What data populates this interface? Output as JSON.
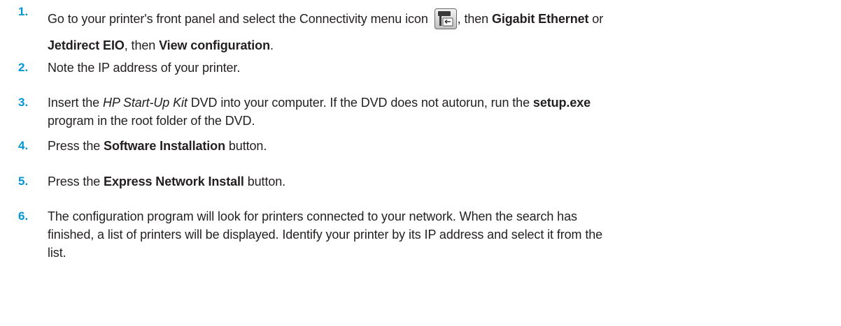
{
  "steps": [
    {
      "number": "1.",
      "parts": {
        "a": "Go to your printer's front panel and select the Connectivity menu icon",
        "b": ", then ",
        "c": "Gigabit Ethernet",
        "d": " or",
        "e": "Jetdirect EIO",
        "f": ", then ",
        "g": "View configuration",
        "h": "."
      },
      "icon": "connectivity-menu-icon"
    },
    {
      "number": "2.",
      "parts": {
        "a": "Note the IP address of your printer."
      }
    },
    {
      "number": "3.",
      "parts": {
        "a": "Insert the ",
        "b": "HP Start-Up Kit",
        "c": " DVD into your computer. If the DVD does not autorun, run the ",
        "d": "setup.exe",
        "e": "program in the root folder of the DVD."
      }
    },
    {
      "number": "4.",
      "parts": {
        "a": "Press the ",
        "b": "Software Installation",
        "c": " button."
      }
    },
    {
      "number": "5.",
      "parts": {
        "a": "Press the ",
        "b": "Express Network Install",
        "c": " button."
      }
    },
    {
      "number": "6.",
      "parts": {
        "a": "The configuration program will look for printers connected to your network. When the search has",
        "b": "finished, a list of printers will be displayed. Identify your printer by its IP address and select it from the",
        "c": "list."
      }
    }
  ],
  "colors": {
    "step_number": "#0096d6",
    "text": "#231f20"
  }
}
